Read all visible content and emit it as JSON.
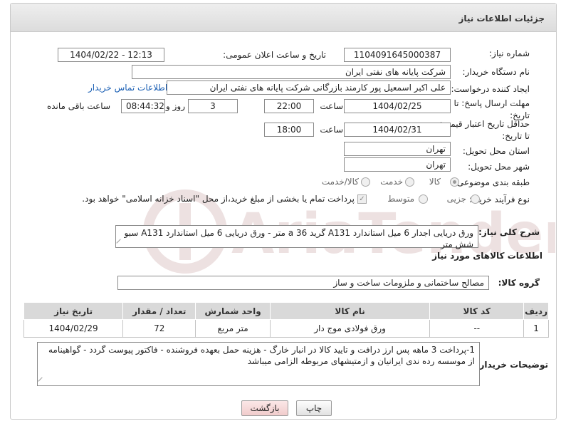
{
  "header": {
    "title": "جزئیات اطلاعات نیاز"
  },
  "fields": {
    "need_number_label": "شماره نیاز:",
    "need_number": "1104091645000387",
    "announce_label": "تاریخ و ساعت اعلان عمومی:",
    "announce_value": "1404/02/22 - 12:13",
    "buyer_org_label": "نام دستگاه خریدار:",
    "buyer_org": "شرکت پایانه های نفتی ایران",
    "creator_label": "ایجاد کننده درخواست:",
    "creator": "علی اکبر اسمعیل پور کارمند بازرگانی شرکت پایانه های نفتی ایران",
    "contact_link": "اطلاعات تماس خریدار",
    "deadline_label": "مهلت ارسال پاسخ: تا تاریخ:",
    "deadline_date": "1404/02/25",
    "time_label": "ساعت",
    "deadline_time": "22:00",
    "days_value": "3",
    "days_and_label": "روز و",
    "remaining_time": "08:44:32",
    "remaining_label": "ساعت باقی مانده",
    "price_validity_label": "حداقل تاریخ اعتبار قیمت: تا تاریخ:",
    "price_validity_date": "1404/02/31",
    "price_validity_time": "18:00",
    "province_label": "استان محل تحویل:",
    "province": "تهران",
    "city_label": "شهر محل تحویل:",
    "city": "تهران",
    "category_label": "طبقه بندی موضوعی:",
    "category_options": [
      "کالا",
      "خدمت",
      "کالا/خدمت"
    ],
    "process_label": "نوع فرآیند خرید :",
    "process_options": [
      "جزیی",
      "متوسط"
    ],
    "payment_note": "پرداخت تمام یا بخشی از مبلغ خرید،از محل \"اسناد خزانه اسلامی\" خواهد بود.",
    "description_label": "شرح کلی نیاز:",
    "description": "ورق دریایی اجدار  6 میل  استاندارد A131 گرید 36 a متر - ورق دریایی 6 میل استاندارد A131 سبو شش متر"
  },
  "goods": {
    "section_title": "اطلاعات کالاهای مورد نیاز",
    "group_label": "گروه کالا:",
    "group_value": "مصالح ساختمانی و ملزومات ساخت و ساز",
    "columns": [
      "ردیف",
      "کد کالا",
      "نام کالا",
      "واحد شمارش",
      "تعداد / مقدار",
      "تاریخ نیاز"
    ],
    "rows": [
      [
        "1",
        "--",
        "ورق فولادی موج دار",
        "متر مربع",
        "72",
        "1404/02/29"
      ]
    ]
  },
  "buyer_notes": {
    "label": "توضیحات خریدار:",
    "text": "1-پرداخت 3 ماهه پس ارز درافت و تایید کالا  در انبار خارگ - هزینه حمل بعهده فروشنده - فاکتور پیوست گردد - گواهینامه از موسسه رده ندی ایرانیان و ازمتیشهای مربوطه الزامی میباشد"
  },
  "buttons": {
    "print": "چاپ",
    "back": "بازگشت"
  },
  "watermark": {
    "text": "AriaTender.neT"
  }
}
